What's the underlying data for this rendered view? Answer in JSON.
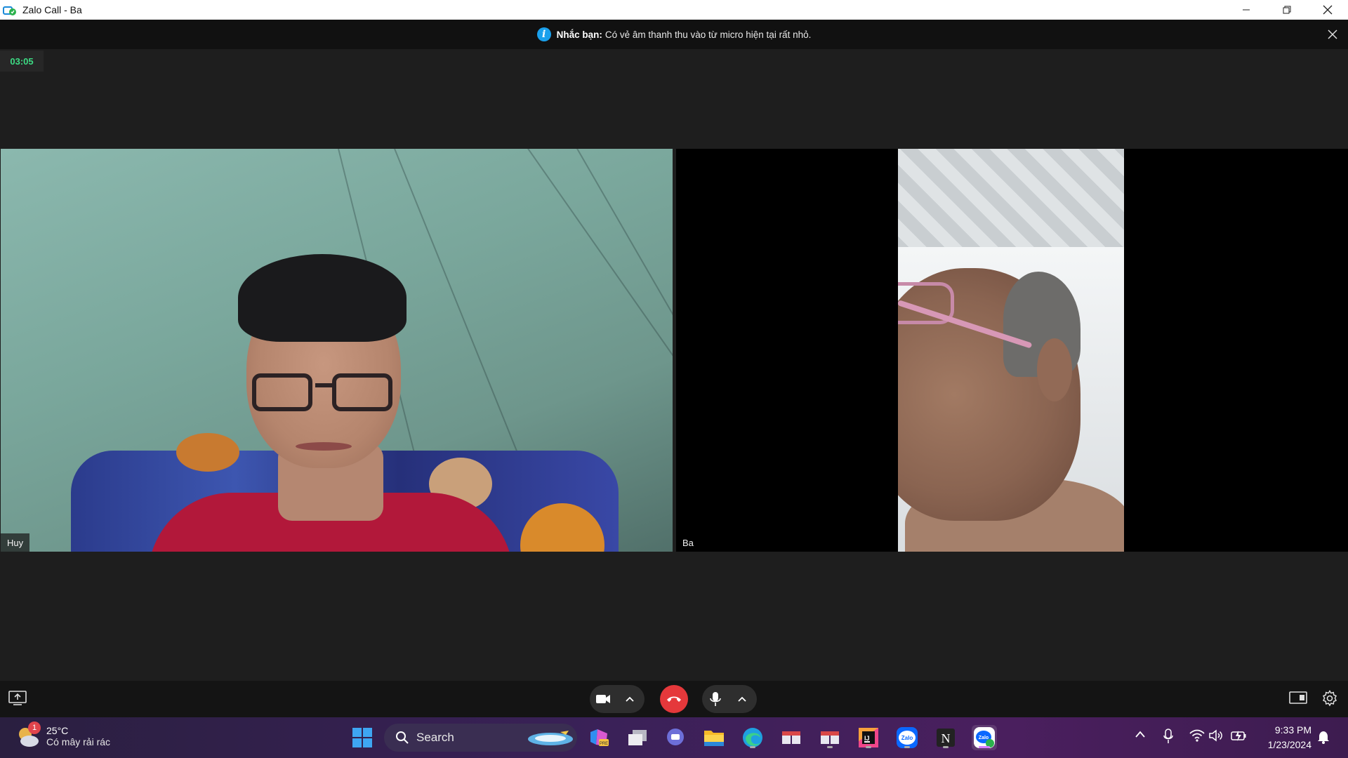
{
  "window": {
    "title": "Zalo Call - Ba",
    "controls": {
      "minimize": "—",
      "restore": "❐",
      "close": "✕"
    }
  },
  "notice": {
    "bold": "Nhắc bạn:",
    "message": "Có vẻ âm thanh thu vào từ micro hiện tại rất nhỏ.",
    "icon": "info-icon"
  },
  "call": {
    "timer": "03:05",
    "participants": [
      {
        "name": "Huy"
      },
      {
        "name": "Ba"
      }
    ],
    "end_call_color": "#e5383b",
    "timer_color": "#3ddc84"
  },
  "taskbar": {
    "weather": {
      "badge": "1",
      "temperature": "25°C",
      "description": "Có mây rải rác"
    },
    "search_label": "Search",
    "apps": [
      "windows-start-icon",
      "copilot-icon",
      "task-view-icon",
      "teams-chat-icon",
      "file-explorer-icon",
      "edge-icon",
      "app-icon-1",
      "app-icon-2",
      "intellij-icon",
      "zalo-icon",
      "notion-icon",
      "zalo-call-icon"
    ],
    "clock": {
      "time": "9:33 PM",
      "date": "1/23/2024"
    }
  }
}
